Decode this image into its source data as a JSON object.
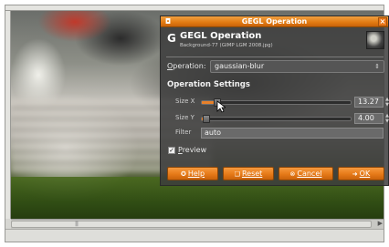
{
  "dialog": {
    "title": "GEGL Operation",
    "header_title": "GEGL Operation",
    "header_subtitle": "Background-77 (GIMP LGM 2008.jpg)",
    "operation_label": "Operation:",
    "operation_value": "gaussian-blur",
    "settings_title": "Operation Settings",
    "params": [
      {
        "label": "Size X",
        "value": "13.27",
        "fraction": 0.09
      },
      {
        "label": "Size Y",
        "value": "4.00",
        "fraction": 0.02
      }
    ],
    "filter_label": "Filter",
    "filter_value": "auto",
    "preview_label": "Preview",
    "preview_checked": true,
    "buttons": {
      "help": "Help",
      "reset": "Reset",
      "cancel": "Cancel",
      "ok": "OK"
    }
  },
  "colors": {
    "accent": "#e67a18",
    "dialog_bg": "#3c3c3c"
  }
}
